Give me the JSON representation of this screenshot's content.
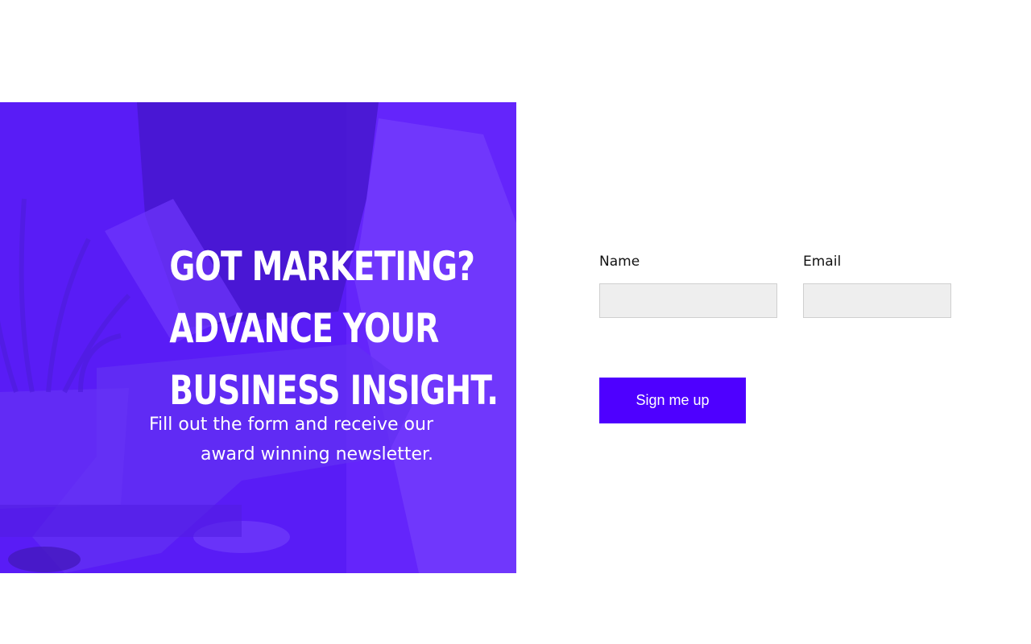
{
  "hero": {
    "title_lines": [
      "GOT MARKETING?",
      "ADVANCE YOUR",
      "BUSINESS INSIGHT."
    ],
    "subtitle_lines": [
      "Fill out the form and receive our",
      "award winning newsletter."
    ],
    "overlay_color": "#5a1cf6"
  },
  "form": {
    "name_label": "Name",
    "name_value": "",
    "email_label": "Email",
    "email_value": "",
    "submit_label": "Sign me up",
    "submit_color": "#4e00ff",
    "input_background": "#eeeeee"
  }
}
